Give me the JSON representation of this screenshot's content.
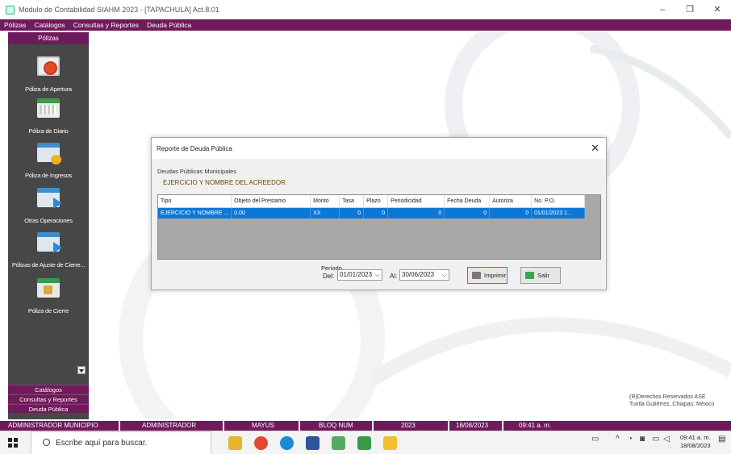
{
  "window": {
    "title": "Módulo de Contabilidad SIAHM 2023 - [TAPACHULA] Act.8.01",
    "minimize": "–",
    "restore": "❐",
    "close": "✕"
  },
  "menu": [
    "Pólizas",
    "Catálogos",
    "Consultas y Reportes",
    "Deuda Pública"
  ],
  "sidebar": {
    "header": "Pólizas",
    "items": [
      {
        "label": "Póliza de Apertura",
        "icon": "apertura-icon"
      },
      {
        "label": "Póliza de Diario",
        "icon": "diario-icon"
      },
      {
        "label": "Póliza de Ingresos",
        "icon": "ingresos-icon"
      },
      {
        "label": "Otras Operaciones",
        "icon": "otras-operaciones-icon"
      },
      {
        "label": "Pólizas de Ajuste de Cierre...",
        "icon": "ajuste-cierre-icon"
      },
      {
        "label": "Póliza de Cierre",
        "icon": "cierre-icon"
      }
    ],
    "bottom": [
      "Catálogos",
      "Consultas y Reportes",
      "Deuda Pública"
    ]
  },
  "dialog": {
    "title": "Reporte de Deuda Pública",
    "close": "✕",
    "group_label": "Deudas Públicas Municipales",
    "group_value": "EJERCICIO Y NOMBRE DEL ACREEDOR",
    "columns": [
      "Tipo",
      "Objeto del Prestamo",
      "Monto",
      "Tasa",
      "Plazo",
      "Periodicidad",
      "Fecha Deuda",
      "Autoriza",
      "No. P.O."
    ],
    "rows": [
      [
        "EJERCICIO Y NOMBRE ...",
        "0.00",
        "XX",
        "0",
        "0",
        "0",
        "0",
        "0",
        "01/01/2023 1..."
      ]
    ],
    "periodo_label": "Periodo",
    "del_label": "Del:",
    "del_value": "01/01/2023",
    "al_label": "Al:",
    "al_value": "30/06/2023",
    "print_label": "Imprimir",
    "exit_label": "Salir"
  },
  "copyright": {
    "line1": "(R)Derechos Reservados ASE",
    "line2": "Tuxtla Gutiérrez, Chiapas; México"
  },
  "status": {
    "user": "ADMINISTRADOR MUNICIPIO",
    "role": "ADMINISTRADOR",
    "caps": "MAYUS",
    "num": "BLOQ NUM",
    "year": "2023",
    "date": "18/08/2023",
    "time": "09:41 a. m."
  },
  "taskbar": {
    "search_placeholder": "Escribe aquí para buscar.",
    "clock_time": "09:41 a. m.",
    "clock_date": "18/08/2023"
  }
}
